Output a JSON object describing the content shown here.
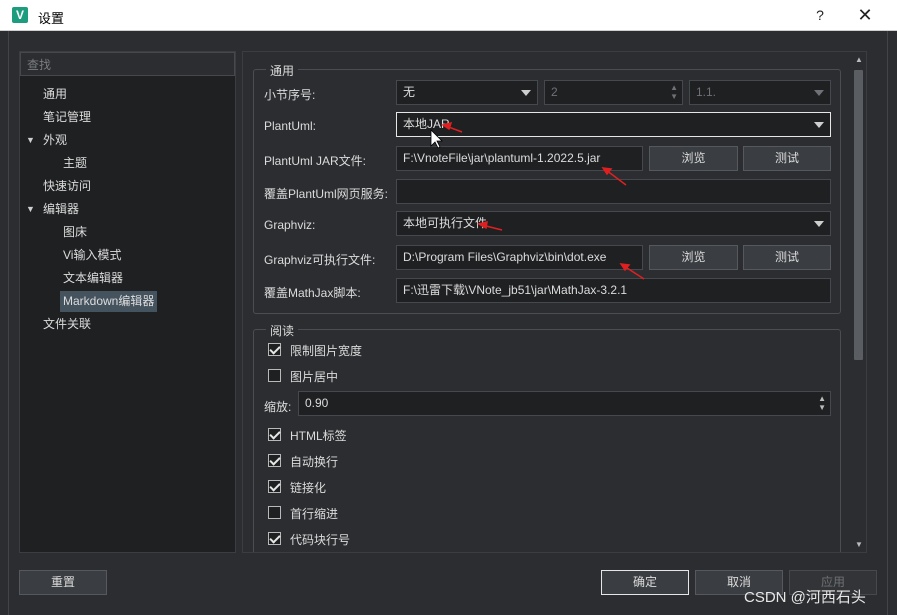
{
  "window": {
    "title": "设置",
    "icon_letter": "V",
    "help_label": "?",
    "close_label": "✕"
  },
  "search": {
    "placeholder": "查找"
  },
  "tree": {
    "items": [
      {
        "label": "通用"
      },
      {
        "label": "笔记管理"
      },
      {
        "label": "外观",
        "expand": "▼"
      },
      {
        "label": "主题"
      },
      {
        "label": "快速访问"
      },
      {
        "label": "编辑器",
        "expand": "▼"
      },
      {
        "label": "图床"
      },
      {
        "label": "Vi输入模式"
      },
      {
        "label": "文本编辑器"
      },
      {
        "label": "Markdown编辑器"
      },
      {
        "label": "文件关联"
      }
    ]
  },
  "general": {
    "title": "通用",
    "section_number": {
      "label": "小节序号:",
      "value": "无",
      "level": "2",
      "format": "1.1."
    },
    "plantuml": {
      "label": "PlantUml:",
      "value": "本地JAR"
    },
    "plantuml_jar": {
      "label": "PlantUml JAR文件:",
      "value": "F:\\VnoteFile\\jar\\plantuml-1.2022.5.jar",
      "browse": "浏览",
      "test": "测试"
    },
    "plantuml_web": {
      "label": "覆盖PlantUml网页服务:",
      "value": ""
    },
    "graphviz": {
      "label": "Graphviz:",
      "value": "本地可执行文件"
    },
    "graphviz_exe": {
      "label": "Graphviz可执行文件:",
      "value": "D:\\Program Files\\Graphviz\\bin\\dot.exe",
      "browse": "浏览",
      "test": "测试"
    },
    "mathjax": {
      "label": "覆盖MathJax脚本:",
      "value": "F:\\迅雷下载\\VNote_jb51\\jar\\MathJax-3.2.1"
    }
  },
  "reading": {
    "title": "阅读",
    "constrain_image_width": {
      "label": "限制图片宽度",
      "checked": true
    },
    "center_image": {
      "label": "图片居中",
      "checked": false
    },
    "zoom": {
      "label": "缩放:",
      "value": "0.90"
    },
    "html_tag": {
      "label": "HTML标签",
      "checked": true
    },
    "auto_break": {
      "label": "自动换行",
      "checked": true
    },
    "linkify": {
      "label": "链接化",
      "checked": true
    },
    "indent_first_line": {
      "label": "首行缩进",
      "checked": false
    },
    "code_block_line_number": {
      "label": "代码块行号",
      "checked": true
    }
  },
  "buttons": {
    "reset": "重置",
    "ok": "确定",
    "cancel": "取消",
    "apply": "应用"
  },
  "watermark": "CSDN @河西石头",
  "colors": {
    "accent_red": "#e02020",
    "background": "#2b2d30",
    "field": "#1f2022"
  }
}
